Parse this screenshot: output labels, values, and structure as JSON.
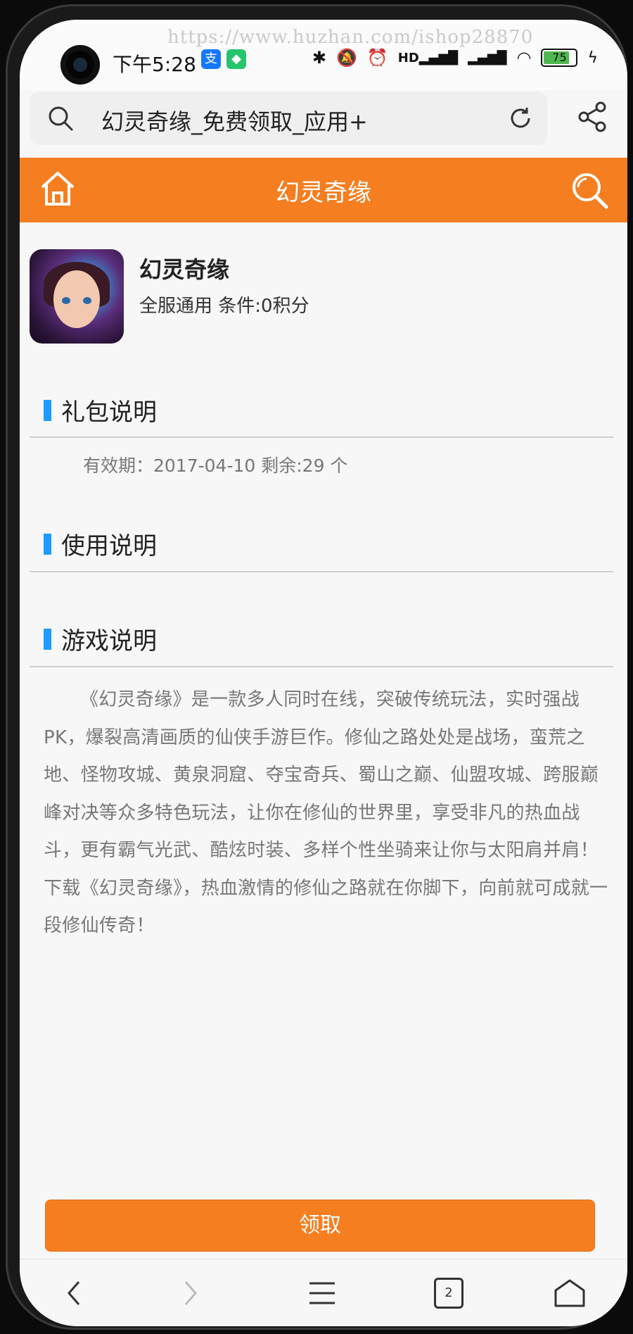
{
  "watermark": "https://www.huzhan.com/ishop28870",
  "status_bar": {
    "time": "下午5:28",
    "battery_level": "75",
    "network": "HD"
  },
  "address_bar": {
    "url_text": "幻灵奇缘_免费领取_应用+"
  },
  "header": {
    "title": "幻灵奇缘"
  },
  "app": {
    "name": "幻灵奇缘",
    "subtitle": "全服通用 条件:0积分"
  },
  "sections": {
    "gift": {
      "title": "礼包说明",
      "validity": "有效期：2017-04-10 剩余:29 个"
    },
    "usage": {
      "title": "使用说明"
    },
    "game": {
      "title": "游戏说明",
      "description": "《幻灵奇缘》是一款多人同时在线，突破传统玩法，实时强战PK，爆裂高清画质的仙侠手游巨作。修仙之路处处是战场，蛮荒之地、怪物攻城、黄泉洞窟、夺宝奇兵、蜀山之巅、仙盟攻城、跨服巅峰对决等众多特色玩法，让你在修仙的世界里，享受非凡的热血战斗，更有霸气光武、酷炫时装、多样个性坐骑来让你与太阳肩并肩！下载《幻灵奇缘》，热血激情的修仙之路就在你脚下，向前就可成就一段修仙传奇！"
    }
  },
  "claim_button": {
    "label": "领取"
  },
  "browser_nav": {
    "tab_count": "2"
  },
  "colors": {
    "accent": "#f57e20",
    "section_marker": "#1e9bff"
  }
}
